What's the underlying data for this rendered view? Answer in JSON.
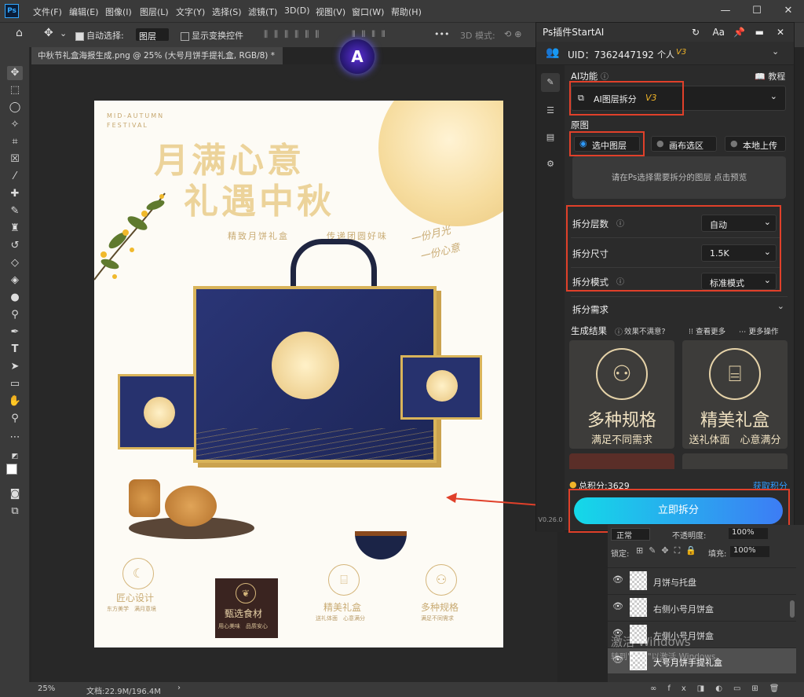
{
  "menubar": {
    "logo": "Ps",
    "items": [
      "文件(F)",
      "编辑(E)",
      "图像(I)",
      "图层(L)",
      "文字(Y)",
      "选择(S)",
      "滤镜(T)",
      "3D(D)",
      "视图(V)",
      "窗口(W)",
      "帮助(H)"
    ],
    "minimize": "—",
    "maximize": "☐",
    "close": "✕"
  },
  "options": {
    "auto_select_label": "自动选择:",
    "auto_select_value": "图层",
    "transform_label": "显示变换控件",
    "mode_label": "3D 模式:",
    "more": "•••"
  },
  "document": {
    "tab_title": "中秋节礼盒海报生成.png @ 25% (大号月饼手提礼盒, RGB/8) *",
    "close": "×"
  },
  "poster": {
    "eyebrow": "MID-AUTUMN\nFESTIVAL",
    "title_line1": "月满心意",
    "title_line2": "礼遇中秋",
    "subtitle_left": "精致月饼礼盒",
    "subtitle_right": "传递团圆好味",
    "side_line1": "一份月光",
    "side_line2": "一份心意",
    "features": [
      {
        "title": "匠心设计",
        "desc": "东方美学　满月意境"
      },
      {
        "title": "甄选食材",
        "desc": "用心美味　品质安心"
      },
      {
        "title": "精美礼盒",
        "desc": "送礼体面　心意满分"
      },
      {
        "title": "多种规格",
        "desc": "满足不同需求"
      }
    ]
  },
  "status": {
    "zoom": "25%",
    "doc": "文档:22.9M/196.4M",
    "arrow": "›"
  },
  "plugin": {
    "title": "Ps插件StartAI",
    "uid_label": "UID：7362447192",
    "account": "个人",
    "version_badge": "V3",
    "ai_label": "AI功能",
    "tutorial": "教程",
    "feature_select": "AI图层拆分",
    "feature_badge": "V3",
    "source_label": "原图",
    "source_options": [
      "选中图层",
      "画布选区",
      "本地上传"
    ],
    "hint": "请在Ps选择需要拆分的图层 点击预览",
    "params": [
      {
        "label": "拆分层数",
        "value": "自动"
      },
      {
        "label": "拆分尺寸",
        "value": "1.5K"
      },
      {
        "label": "拆分模式",
        "value": "标准模式"
      }
    ],
    "requirements": "拆分需求",
    "results_label": "生成结果",
    "results_hint": "效果不满意?",
    "view_more": "查看更多",
    "more_ops": "更多操作",
    "cards": [
      {
        "title": "多种规格",
        "desc": "满足不同需求"
      },
      {
        "title": "精美礼盒",
        "desc": "送礼体面　心意满分"
      }
    ],
    "points_label": "总积分:3629",
    "get_points": "获取积分",
    "split_button": "立即拆分",
    "version": "V0.26.0"
  },
  "layers": {
    "blend_mode": "正常",
    "opacity_label": "不透明度:",
    "opacity": "100%",
    "lock_label": "锁定:",
    "fill_label": "填充:",
    "fill": "100%",
    "items": [
      "月饼与托盘",
      "右侧小号月饼盒",
      "左侧小号月饼盒",
      "大号月饼手提礼盒"
    ]
  },
  "watermark": {
    "line1": "激活 Windows",
    "line2": "转到\"设置\"以激活 Windows。"
  },
  "colors": {
    "accent_red": "#e0402a",
    "button_gradient_start": "#14d9e8",
    "button_gradient_end": "#3d7cf5",
    "gold": "#d9b45a",
    "navy": "#24306e"
  }
}
